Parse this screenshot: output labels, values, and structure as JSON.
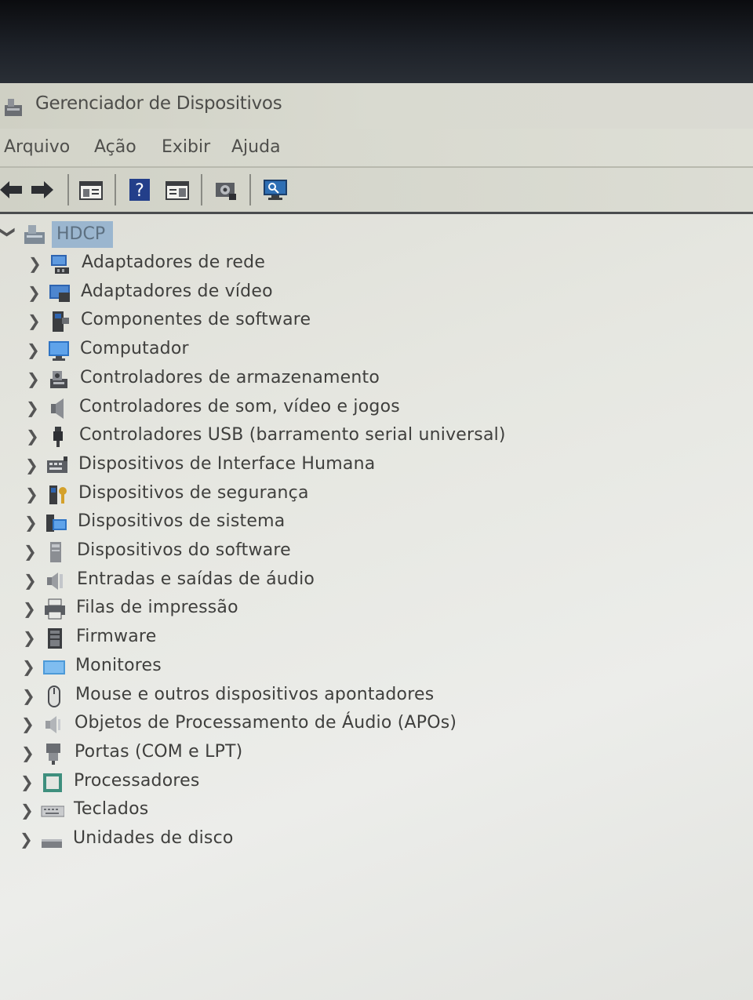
{
  "window": {
    "title": "Gerenciador de Dispositivos",
    "app_icon": "device-manager-icon"
  },
  "menu": {
    "items": [
      "Arquivo",
      "Ação",
      "Exibir",
      "Ajuda"
    ]
  },
  "toolbar": {
    "buttons": [
      "back-arrow-icon",
      "forward-arrow-icon",
      "properties-icon",
      "help-icon",
      "details-view-icon",
      "update-driver-icon",
      "scan-hardware-icon"
    ]
  },
  "tree": {
    "root": {
      "label": "HDCP",
      "expanded": true,
      "icon": "computer-root-icon"
    },
    "nodes": [
      {
        "label": "Adaptadores de rede",
        "icon": "network-adapter-icon"
      },
      {
        "label": "Adaptadores de vídeo",
        "icon": "display-adapter-icon"
      },
      {
        "label": "Componentes de software",
        "icon": "software-component-icon"
      },
      {
        "label": "Computador",
        "icon": "computer-icon"
      },
      {
        "label": "Controladores de armazenamento",
        "icon": "storage-controller-icon"
      },
      {
        "label": "Controladores de som, vídeo e jogos",
        "icon": "speaker-icon"
      },
      {
        "label": "Controladores USB (barramento serial universal)",
        "icon": "usb-icon"
      },
      {
        "label": "Dispositivos de Interface Humana",
        "icon": "hid-icon"
      },
      {
        "label": "Dispositivos de segurança",
        "icon": "security-key-icon"
      },
      {
        "label": "Dispositivos de sistema",
        "icon": "system-device-icon"
      },
      {
        "label": "Dispositivos do software",
        "icon": "software-device-icon"
      },
      {
        "label": "Entradas e saídas de áudio",
        "icon": "audio-io-icon"
      },
      {
        "label": "Filas de impressão",
        "icon": "printer-icon"
      },
      {
        "label": "Firmware",
        "icon": "firmware-icon"
      },
      {
        "label": "Monitores",
        "icon": "monitor-icon"
      },
      {
        "label": "Mouse e outros dispositivos apontadores",
        "icon": "mouse-icon"
      },
      {
        "label": "Objetos de Processamento de Áudio (APOs)",
        "icon": "audio-apo-icon"
      },
      {
        "label": "Portas (COM e LPT)",
        "icon": "port-icon"
      },
      {
        "label": "Processadores",
        "icon": "processor-icon"
      },
      {
        "label": "Teclados",
        "icon": "keyboard-icon"
      },
      {
        "label": "Unidades de disco",
        "icon": "disk-drive-icon"
      }
    ]
  }
}
